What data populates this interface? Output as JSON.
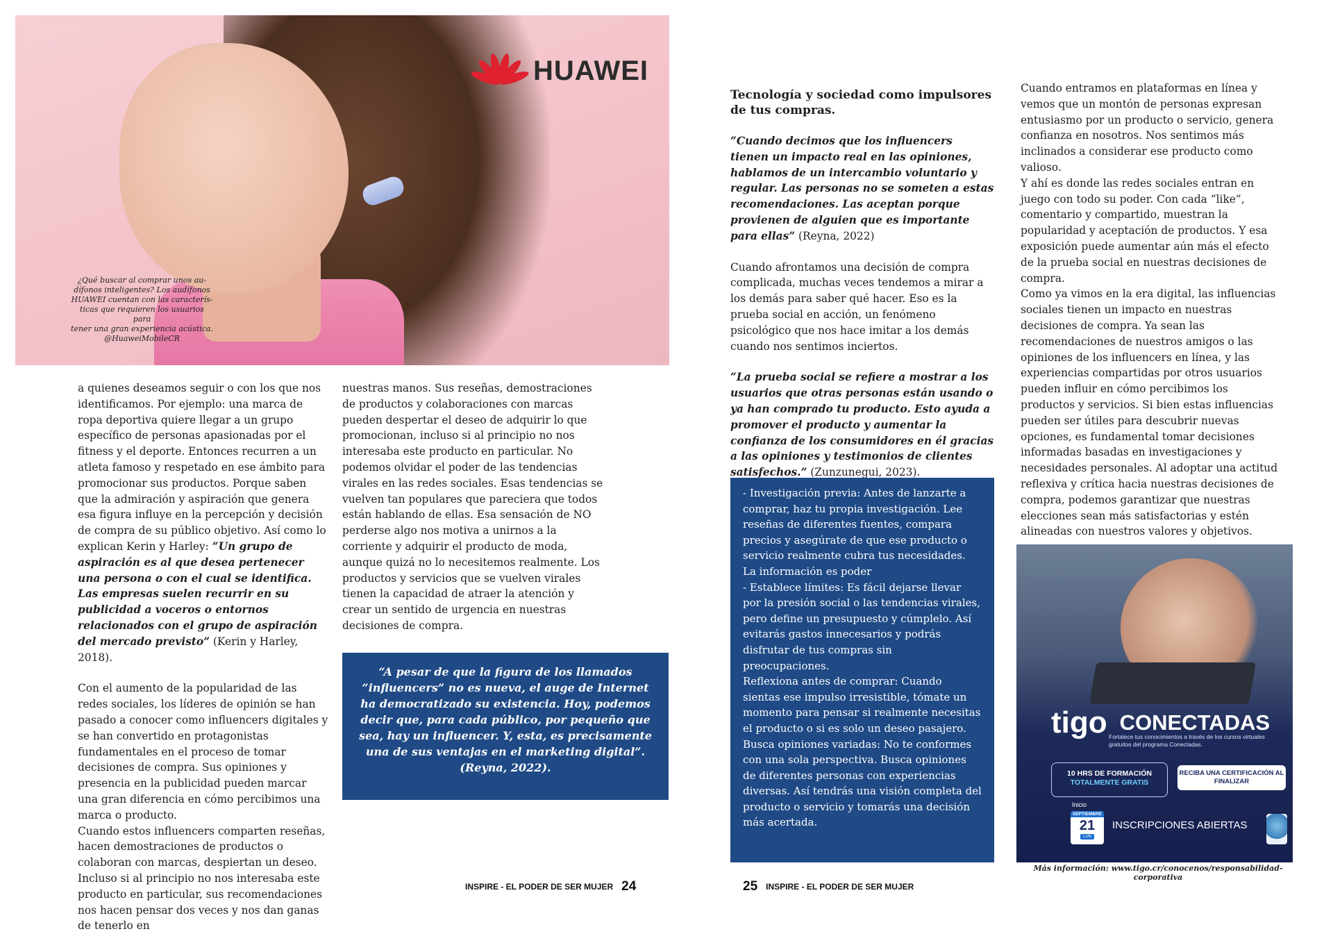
{
  "left_page": {
    "hero": {
      "brand": "HUAWEI",
      "caption": [
        "¿Qué buscar al comprar unos au-",
        "dífonos inteligentes? Los audífonos",
        "HUAWEI cuentan con las caracterís-",
        "ticas que requieren los usuarios para",
        "tener una gran experiencia acústica.",
        "@HuaweiMobileCR"
      ]
    },
    "col1": {
      "p1": "a quienes deseamos seguir o con los que nos identificamos. Por ejemplo: una marca de ropa deportiva quiere llegar a un grupo específico de personas apasionadas por el fitness y el deporte. Entonces recurren a un atleta famoso y respetado en ese ámbito para promocionar sus productos. Porque saben que la admiración y aspiración que genera esa figura influye en la percepción y decisión de compra de su público objetivo. Así como lo explican Kerin y Harley: ",
      "p1_quote": "“Un grupo de aspiración es al que desea pertenecer una persona o con el cual se identifica. Las empresas suelen recurrir en su publicidad a voceros o entornos relacionados con el grupo de aspiración del mercado previsto”",
      "p1_cite": " (Kerin y Harley, 2018).",
      "p2": "Con el aumento de la popularidad de las redes sociales, los líderes de opinión se han pasado a conocer como influencers digitales y se han convertido en protagonistas fundamentales en el proceso de tomar decisiones de compra. Sus opiniones y presencia en la publicidad pueden marcar una gran diferencia en cómo percibimos una marca o producto.",
      "p3": "Cuando estos influencers comparten reseñas, hacen demostraciones de productos o colaboran con marcas, despiertan un deseo. Incluso si al principio no nos interesaba este producto en particular, sus recomendaciones nos hacen pensar dos veces y nos dan ganas de tenerlo en"
    },
    "col2": {
      "p1": "nuestras manos. Sus reseñas, demostraciones de productos y colaboraciones con marcas pueden despertar el deseo de adquirir lo que promocionan, incluso si al principio no nos interesaba este producto en particular.  No podemos olvidar el poder de las tendencias virales en las redes sociales. Esas tendencias se vuelven tan populares que pareciera que todos están hablando de ellas. Esa sensación de NO perderse algo nos motiva a unirnos a la corriente y adquirir el producto de moda, aunque quizá no lo necesitemos realmente. Los productos y servicios que se vuelven virales tienen la capacidad de atraer la atención y crear un sentido de urgencia en nuestras decisiones de compra."
    },
    "quote_box": "“A pesar de que la figura de los llamados “influencers” no es nueva, el auge de Internet ha democratizado su existencia. Hoy, podemos decir que, para cada público, por pequeño que sea, hay un influencer. Y, esta, es precisamente una de sus ventajas en el marketing digital”. (Reyna, 2022).",
    "folio": {
      "title": "INSPIRE - EL PODER DE SER MUJER",
      "number": "24"
    }
  },
  "right_page": {
    "col1": {
      "heading": "Tecnología y sociedad como impulsores de tus compras.",
      "quote1": "“Cuando decimos que los influencers tienen un impacto real en las opiniones, hablamos de un intercambio voluntario y regular. Las personas no se someten a estas recomendaciones. Las aceptan porque provienen de alguien que es importante para ellas”",
      "quote1_cite": " (Reyna, 2022)",
      "p1": "Cuando afrontamos una decisión de compra complicada, muchas veces tendemos a mirar a los demás para saber qué hacer. Eso es la prueba social en acción, un fenómeno psicológico que nos hace imitar a los demás cuando nos sentimos inciertos.",
      "quote2": "“La prueba social se refiere a mostrar a los usuarios que otras personas están usando o ya han comprado tu producto. Esto ayuda a promover el producto y aumentar la confianza de los consumidores en él gracias a las opiniones y testimonios de clientes satisfechos.”",
      "quote2_cite": " (Zunzunegui, 2023)."
    },
    "tips": [
      "- Investigación previa: Antes de lanzarte a comprar, haz tu propia investigación. Lee reseñas de diferentes fuentes, compara precios y asegúrate de que ese producto o servicio realmente cubra tus necesidades. La información es poder",
      "- Establece límites: Es fácil dejarse llevar por la presión social o las tendencias virales, pero define un presupuesto y cúmplelo. Así evitarás gastos innecesarios y podrás disfrutar de tus compras sin preocupaciones.",
      "Reflexiona antes de comprar: Cuando sientas ese impulso irresistible, tómate un momento para pensar si realmente necesitas el producto o si es solo un deseo pasajero.",
      "Busca opiniones variadas: No te conformes con una sola perspectiva. Busca opiniones de diferentes personas con experiencias diversas. Así tendrás una visión completa del producto o servicio y tomarás una decisión más acertada."
    ],
    "col2": {
      "p1": "Cuando entramos en plataformas en línea y vemos que un montón de personas expresan entusiasmo por un producto o servicio, genera confianza en nosotros. Nos sentimos más inclinados a considerar ese producto como valioso.",
      "p2": "Y ahí es donde las redes sociales entran en juego con todo su poder. Con cada “like”, comentario y compartido, muestran la popularidad y aceptación de productos. Y esa exposición puede aumentar aún más el efecto de la prueba social en nuestras decisiones de compra.",
      "p3": "Como ya vimos en la era digital, las influencias sociales tienen un impacto en nuestras decisiones de compra. Ya sean las recomendaciones de nuestros amigos o las opiniones de los influencers en línea, y las experiencias compartidas por otros usuarios pueden influir en cómo percibimos los productos y servicios. Si bien estas influencias pueden ser útiles para descubrir nuevas opciones, es fundamental tomar decisiones informadas basadas en investigaciones y necesidades personales. Al adoptar una actitud reflexiva y crítica hacia nuestras decisiones de compra, podemos garantizar que nuestras elecciones sean más satisfactorias y estén alineadas con nuestros valores y objetivos."
    },
    "ad": {
      "brand": "tigo",
      "program": "CONECTADAS",
      "subtitle": "Fortalece tus conocimientos a través de los cursos virtuales gratuitos del programa Conectadas.",
      "hours_line1": "10 HRS DE FORMACIÓN",
      "hours_line2": "TOTALMENTE GRATIS",
      "cert": "RECIBA UNA CERTIFICACIÓN AL FINALIZAR",
      "start_label": "Inicio",
      "cal_month": "SEPTIEMBRE",
      "cal_day": "21",
      "cal_weekday": "LUN",
      "enroll": "INSCRIPCIONES ABIERTAS",
      "credit": "Más información:  www.tigo.cr/conocenos/responsabilidad-corporativa"
    },
    "folio": {
      "title": "INSPIRE - EL PODER DE SER MUJER",
      "number": "25"
    }
  }
}
